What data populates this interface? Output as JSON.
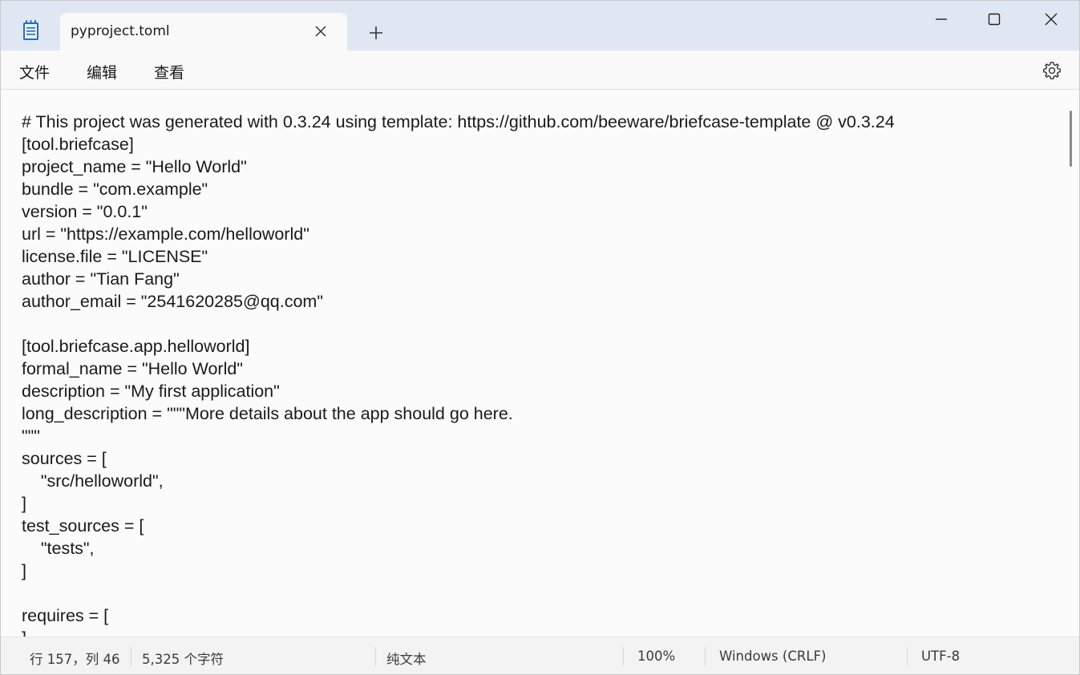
{
  "titlebar": {
    "tab_title": "pyproject.toml",
    "app_icon": "notepad-icon",
    "close_tab_icon": "close-icon",
    "new_tab_icon": "plus-icon",
    "minimize_icon": "minimize-icon",
    "maximize_icon": "maximize-icon",
    "close_window_icon": "close-icon"
  },
  "menu": {
    "file": "文件",
    "edit": "编辑",
    "view": "查看",
    "settings_icon": "gear-icon"
  },
  "editor": {
    "lines": [
      "# This project was generated with 0.3.24 using template: https://github.com/beeware/briefcase-template @ v0.3.24",
      "[tool.briefcase]",
      "project_name = \"Hello World\"",
      "bundle = \"com.example\"",
      "version = \"0.0.1\"",
      "url = \"https://example.com/helloworld\"",
      "license.file = \"LICENSE\"",
      "author = \"Tian Fang\"",
      "author_email = \"2541620285@qq.com\"",
      "",
      "[tool.briefcase.app.helloworld]",
      "formal_name = \"Hello World\"",
      "description = \"My first application\"",
      "long_description = \"\"\"More details about the app should go here.",
      "\"\"\"",
      "sources = [",
      "    \"src/helloworld\",",
      "]",
      "test_sources = [",
      "    \"tests\",",
      "]",
      "",
      "requires = [",
      "]"
    ]
  },
  "status": {
    "position": "行 157，列 46",
    "char_count": "5,325 个字符",
    "format": "纯文本",
    "zoom": "100%",
    "line_ending": "Windows (CRLF)",
    "encoding": "UTF-8"
  }
}
